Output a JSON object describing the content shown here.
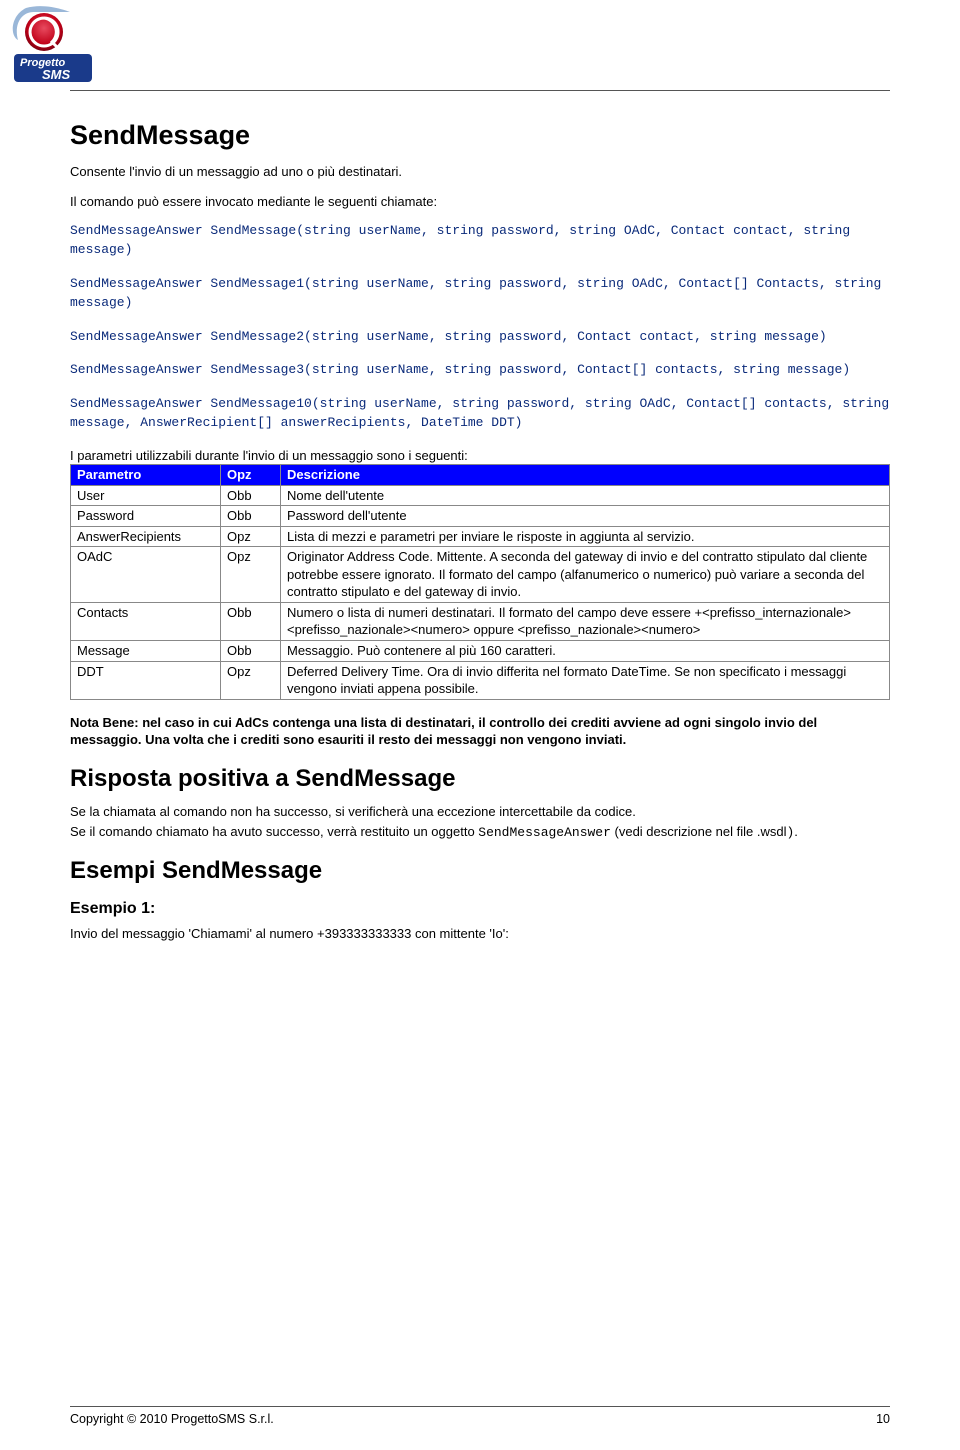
{
  "logo": {
    "top_text": "Progetto",
    "bottom_text": "SMS"
  },
  "h1": "SendMessage",
  "intro": "Consente l'invio di un messaggio ad uno o più destinatari.",
  "cmd_intro": "Il comando può essere invocato mediante le seguenti chiamate:",
  "sig1": "SendMessageAnswer SendMessage(string userName, string password, string OAdC, Contact contact, string message)",
  "sig2": "SendMessageAnswer SendMessage1(string userName, string password, string OAdC, Contact[] Contacts, string message)",
  "sig3": "SendMessageAnswer SendMessage2(string userName, string password, Contact contact, string message)",
  "sig4": "SendMessageAnswer SendMessage3(string userName, string password, Contact[] contacts, string message)",
  "sig5": "SendMessageAnswer SendMessage10(string userName, string password, string OAdC, Contact[] contacts, string message, AnswerRecipient[] answerRecipients, DateTime DDT)",
  "params_intro": "I parametri utilizzabili durante l'invio di un messaggio sono i seguenti:",
  "table": {
    "headers": [
      "Parametro",
      "Opz",
      "Descrizione"
    ],
    "rows": [
      {
        "p": "User",
        "o": "Obb",
        "d": "Nome dell'utente"
      },
      {
        "p": "Password",
        "o": "Obb",
        "d": "Password dell'utente"
      },
      {
        "p": "AnswerRecipients",
        "o": "Opz",
        "d": "Lista di mezzi e parametri per inviare le risposte in aggiunta al servizio."
      },
      {
        "p": "OAdC",
        "o": "Opz",
        "d": "Originator Address Code. Mittente. A seconda del gateway di invio e del contratto stipulato dal cliente potrebbe essere ignorato. Il formato del campo (alfanumerico o numerico) può variare a seconda del contratto stipulato e del gateway di invio."
      },
      {
        "p": "Contacts",
        "o": "Obb",
        "d": "Numero o lista di numeri destinatari. Il formato del campo deve essere +<prefisso_internazionale><prefisso_nazionale><numero> oppure <prefisso_nazionale><numero>"
      },
      {
        "p": "Message",
        "o": "Obb",
        "d": "Messaggio. Può contenere al più 160 caratteri."
      },
      {
        "p": "DDT",
        "o": "Opz",
        "d": "Deferred Delivery Time. Ora di invio differita nel formato DateTime. Se non specificato i messaggi vengono inviati appena possibile."
      }
    ]
  },
  "nb_label": "Nota Bene: ",
  "nb_text": "nel caso in cui AdCs contenga una lista di destinatari, il controllo dei crediti avviene ad ogni singolo invio del messaggio. Una volta che i crediti sono esauriti il resto dei messaggi non vengono inviati.",
  "h2_pos": "Risposta positiva a SendMessage",
  "pos_line1": "Se la chiamata al comando non ha successo, si verificherà una eccezione intercettabile da codice.",
  "pos_line2a": "Se il comando chiamato ha avuto successo, verrà restituito un oggetto ",
  "pos_line2_code": "SendMessageAnswer",
  "pos_line2b": " (vedi descrizione nel file .wsdl",
  "pos_line2_code2": ")",
  "pos_line2c": ".",
  "h2_ex": "Esempi SendMessage",
  "h3_ex1": "Esempio 1:",
  "ex1_text": "Invio del messaggio 'Chiamami' al numero +393333333333 con mittente 'Io':",
  "footer": {
    "copyright": "Copyright © 2010 ProgettoSMS S.r.l.",
    "page": "10"
  }
}
